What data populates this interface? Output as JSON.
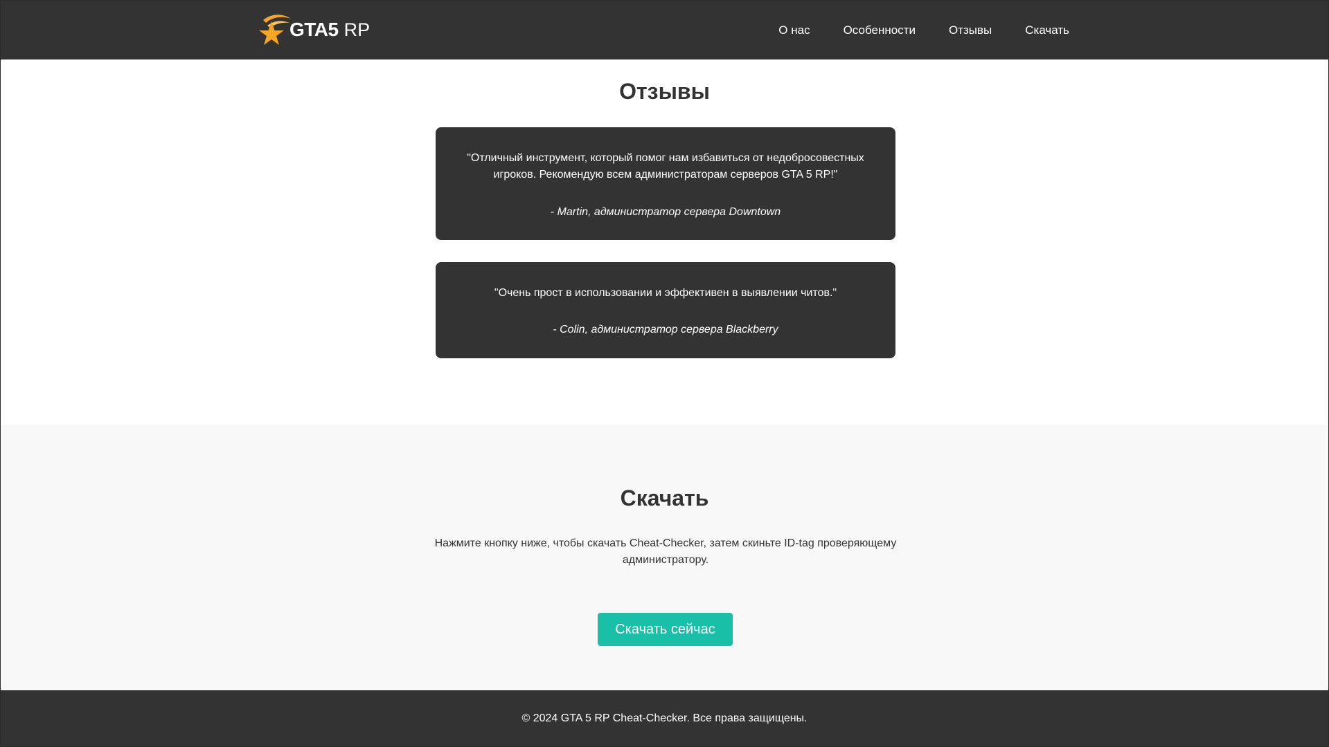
{
  "header": {
    "logo": {
      "text_bold": "GTA5",
      "text_light": "RP",
      "icon": "star-logo-icon"
    },
    "nav": [
      {
        "label": "О нас"
      },
      {
        "label": "Особенности"
      },
      {
        "label": "Отзывы"
      },
      {
        "label": "Скачать"
      }
    ]
  },
  "reviews": {
    "title": "Отзывы",
    "items": [
      {
        "quote": "\"Отличный инструмент, который помог нам избавиться от недобросовестных игроков. Рекомендую всем администраторам серверов GTA 5 RP!\"",
        "author": "- Martin, администратор сервера Downtown"
      },
      {
        "quote": "\"Очень прост в использовании и эффективен в выявлении читов.\"",
        "author": "- Colin, администратор сервера Blackberry"
      }
    ]
  },
  "download": {
    "title": "Скачать",
    "text": "Нажмите кнопку ниже, чтобы скачать Cheat-Checker, затем скиньте ID-tag проверяющему администратору.",
    "button_label": "Скачать сейчас"
  },
  "footer": {
    "text": "© 2024 GTA 5 RP Cheat-Checker. Все права защищены."
  },
  "colors": {
    "dark": "#333333",
    "accent": "#19bfa7",
    "logo_star": "#f5a623",
    "light_bg": "#f8f8f8"
  }
}
